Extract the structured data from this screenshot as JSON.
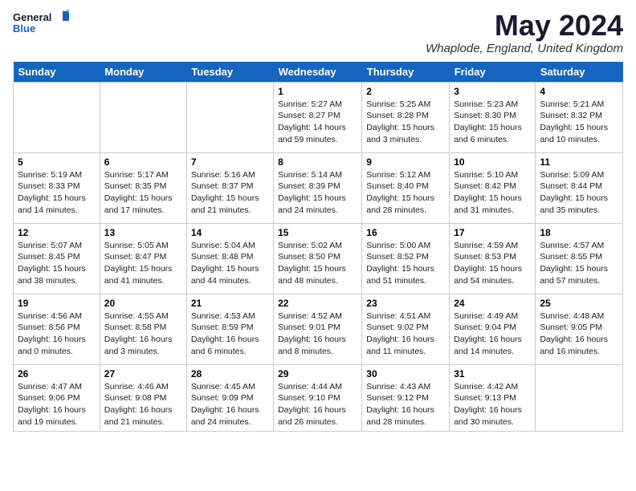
{
  "logo": {
    "general": "General",
    "blue": "Blue"
  },
  "title": "May 2024",
  "subtitle": "Whaplode, England, United Kingdom",
  "days_of_week": [
    "Sunday",
    "Monday",
    "Tuesday",
    "Wednesday",
    "Thursday",
    "Friday",
    "Saturday"
  ],
  "weeks": [
    [
      {
        "day": "",
        "info": ""
      },
      {
        "day": "",
        "info": ""
      },
      {
        "day": "",
        "info": ""
      },
      {
        "day": "1",
        "info": "Sunrise: 5:27 AM\nSunset: 8:27 PM\nDaylight: 14 hours\nand 59 minutes."
      },
      {
        "day": "2",
        "info": "Sunrise: 5:25 AM\nSunset: 8:28 PM\nDaylight: 15 hours\nand 3 minutes."
      },
      {
        "day": "3",
        "info": "Sunrise: 5:23 AM\nSunset: 8:30 PM\nDaylight: 15 hours\nand 6 minutes."
      },
      {
        "day": "4",
        "info": "Sunrise: 5:21 AM\nSunset: 8:32 PM\nDaylight: 15 hours\nand 10 minutes."
      }
    ],
    [
      {
        "day": "5",
        "info": "Sunrise: 5:19 AM\nSunset: 8:33 PM\nDaylight: 15 hours\nand 14 minutes."
      },
      {
        "day": "6",
        "info": "Sunrise: 5:17 AM\nSunset: 8:35 PM\nDaylight: 15 hours\nand 17 minutes."
      },
      {
        "day": "7",
        "info": "Sunrise: 5:16 AM\nSunset: 8:37 PM\nDaylight: 15 hours\nand 21 minutes."
      },
      {
        "day": "8",
        "info": "Sunrise: 5:14 AM\nSunset: 8:39 PM\nDaylight: 15 hours\nand 24 minutes."
      },
      {
        "day": "9",
        "info": "Sunrise: 5:12 AM\nSunset: 8:40 PM\nDaylight: 15 hours\nand 28 minutes."
      },
      {
        "day": "10",
        "info": "Sunrise: 5:10 AM\nSunset: 8:42 PM\nDaylight: 15 hours\nand 31 minutes."
      },
      {
        "day": "11",
        "info": "Sunrise: 5:09 AM\nSunset: 8:44 PM\nDaylight: 15 hours\nand 35 minutes."
      }
    ],
    [
      {
        "day": "12",
        "info": "Sunrise: 5:07 AM\nSunset: 8:45 PM\nDaylight: 15 hours\nand 38 minutes."
      },
      {
        "day": "13",
        "info": "Sunrise: 5:05 AM\nSunset: 8:47 PM\nDaylight: 15 hours\nand 41 minutes."
      },
      {
        "day": "14",
        "info": "Sunrise: 5:04 AM\nSunset: 8:48 PM\nDaylight: 15 hours\nand 44 minutes."
      },
      {
        "day": "15",
        "info": "Sunrise: 5:02 AM\nSunset: 8:50 PM\nDaylight: 15 hours\nand 48 minutes."
      },
      {
        "day": "16",
        "info": "Sunrise: 5:00 AM\nSunset: 8:52 PM\nDaylight: 15 hours\nand 51 minutes."
      },
      {
        "day": "17",
        "info": "Sunrise: 4:59 AM\nSunset: 8:53 PM\nDaylight: 15 hours\nand 54 minutes."
      },
      {
        "day": "18",
        "info": "Sunrise: 4:57 AM\nSunset: 8:55 PM\nDaylight: 15 hours\nand 57 minutes."
      }
    ],
    [
      {
        "day": "19",
        "info": "Sunrise: 4:56 AM\nSunset: 8:56 PM\nDaylight: 16 hours\nand 0 minutes."
      },
      {
        "day": "20",
        "info": "Sunrise: 4:55 AM\nSunset: 8:58 PM\nDaylight: 16 hours\nand 3 minutes."
      },
      {
        "day": "21",
        "info": "Sunrise: 4:53 AM\nSunset: 8:59 PM\nDaylight: 16 hours\nand 6 minutes."
      },
      {
        "day": "22",
        "info": "Sunrise: 4:52 AM\nSunset: 9:01 PM\nDaylight: 16 hours\nand 8 minutes."
      },
      {
        "day": "23",
        "info": "Sunrise: 4:51 AM\nSunset: 9:02 PM\nDaylight: 16 hours\nand 11 minutes."
      },
      {
        "day": "24",
        "info": "Sunrise: 4:49 AM\nSunset: 9:04 PM\nDaylight: 16 hours\nand 14 minutes."
      },
      {
        "day": "25",
        "info": "Sunrise: 4:48 AM\nSunset: 9:05 PM\nDaylight: 16 hours\nand 16 minutes."
      }
    ],
    [
      {
        "day": "26",
        "info": "Sunrise: 4:47 AM\nSunset: 9:06 PM\nDaylight: 16 hours\nand 19 minutes."
      },
      {
        "day": "27",
        "info": "Sunrise: 4:46 AM\nSunset: 9:08 PM\nDaylight: 16 hours\nand 21 minutes."
      },
      {
        "day": "28",
        "info": "Sunrise: 4:45 AM\nSunset: 9:09 PM\nDaylight: 16 hours\nand 24 minutes."
      },
      {
        "day": "29",
        "info": "Sunrise: 4:44 AM\nSunset: 9:10 PM\nDaylight: 16 hours\nand 26 minutes."
      },
      {
        "day": "30",
        "info": "Sunrise: 4:43 AM\nSunset: 9:12 PM\nDaylight: 16 hours\nand 28 minutes."
      },
      {
        "day": "31",
        "info": "Sunrise: 4:42 AM\nSunset: 9:13 PM\nDaylight: 16 hours\nand 30 minutes."
      },
      {
        "day": "",
        "info": ""
      }
    ]
  ]
}
